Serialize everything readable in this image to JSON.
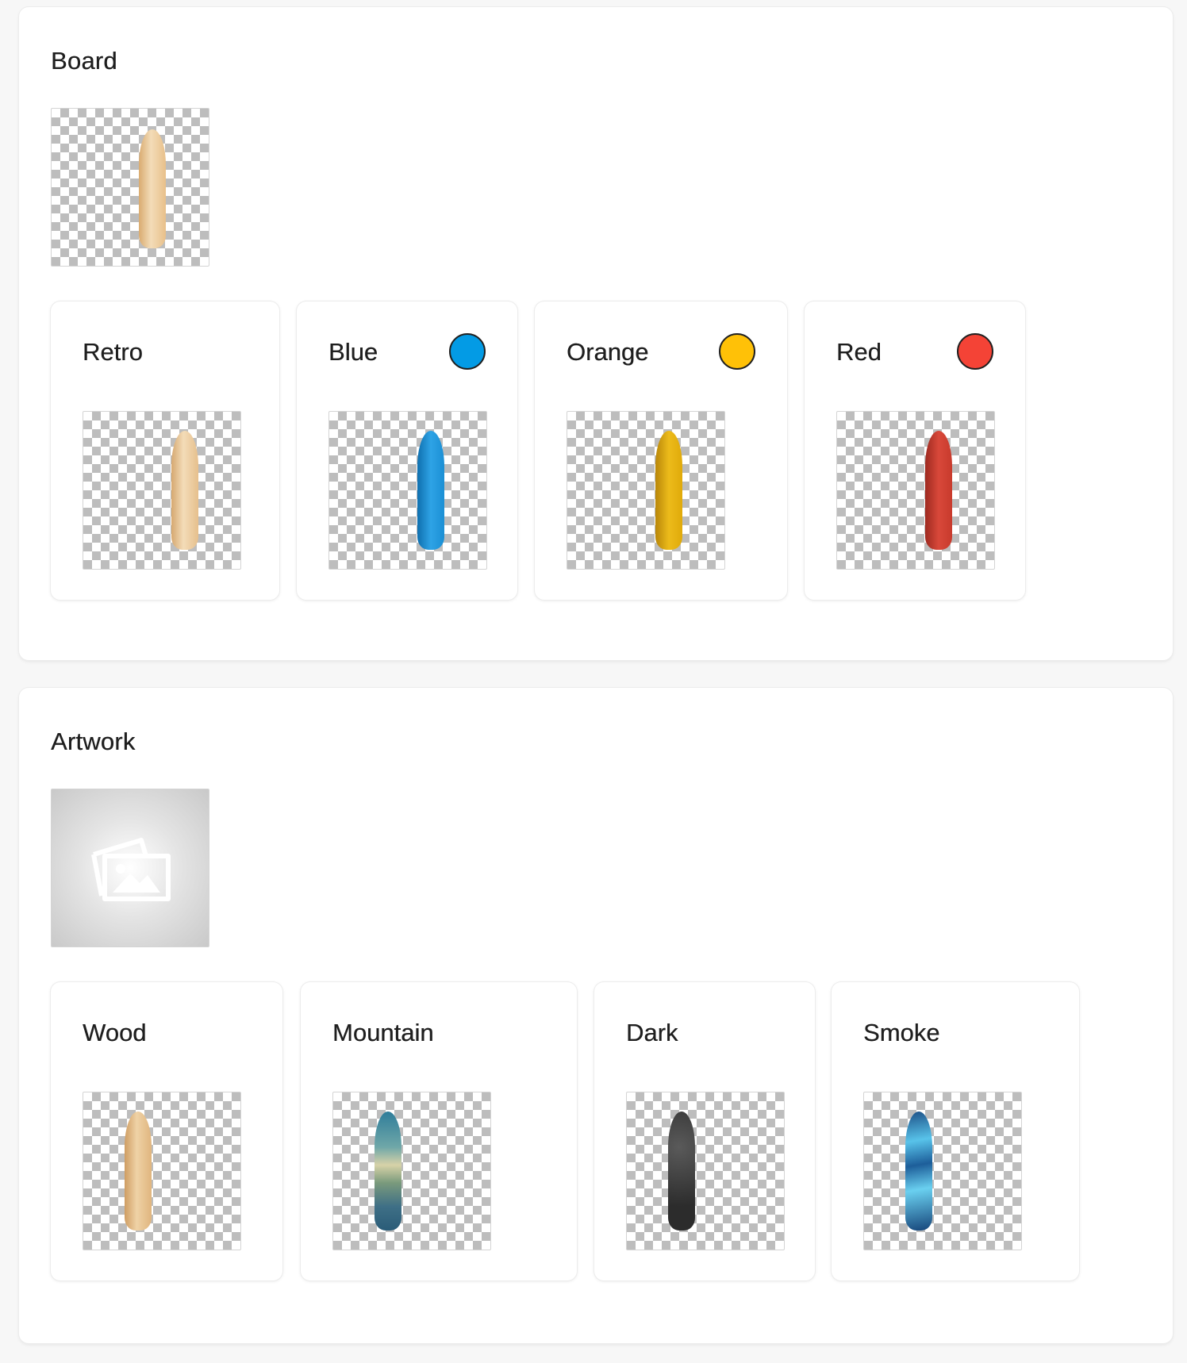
{
  "board": {
    "title": "Board",
    "main_preview_color": "#e8c08a",
    "options": [
      {
        "label": "Retro",
        "board_color": "#e6bf8c",
        "swatch": null
      },
      {
        "label": "Blue",
        "board_color": "#1b8fd4",
        "swatch": "#039be5"
      },
      {
        "label": "Orange",
        "board_color": "#e0aa0a",
        "swatch": "#ffc107"
      },
      {
        "label": "Red",
        "board_color": "#c83a2c",
        "swatch": "#f44336"
      }
    ]
  },
  "artwork": {
    "title": "Artwork",
    "placeholder_icon": "image-placeholder-icon",
    "options": [
      {
        "label": "Wood",
        "board_color": "#e6bf8c"
      },
      {
        "label": "Mountain",
        "board_color": "#4a8aa0"
      },
      {
        "label": "Dark",
        "board_color": "#3a3a3a"
      },
      {
        "label": "Smoke",
        "board_color": "#2c6fa8"
      }
    ]
  }
}
